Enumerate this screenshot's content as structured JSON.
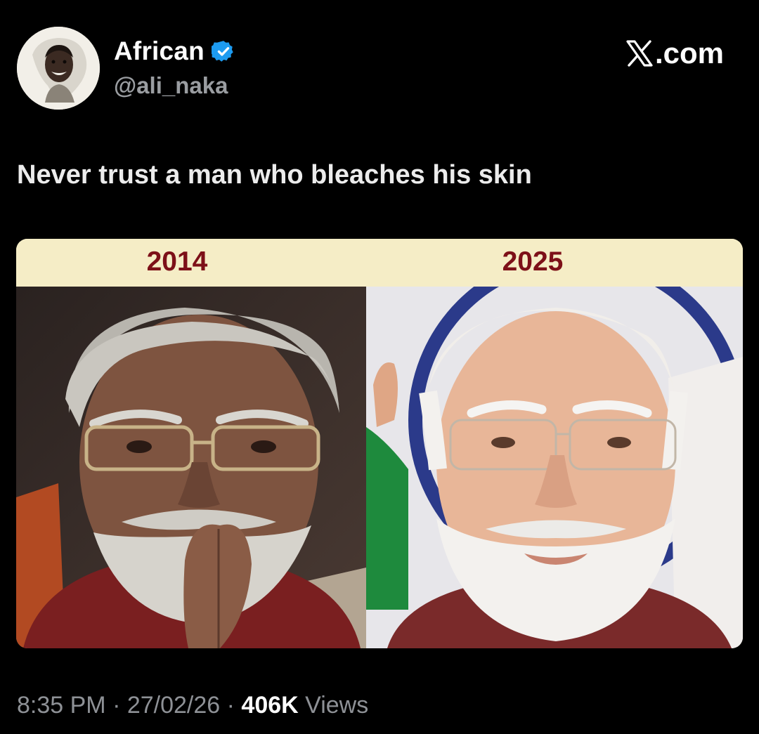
{
  "author": {
    "display_name": "African",
    "handle": "@ali_naka",
    "avatar_icon": "portrait-avatar",
    "verified_icon": "verified-badge-icon",
    "verified_color": "#1d9bf0"
  },
  "brand": {
    "logo_icon": "x-logo-icon",
    "domain_text": ".com"
  },
  "tweet": {
    "text": "Never trust a man who bleaches his skin"
  },
  "media": {
    "header_color": "#f5edc6",
    "year_color": "#7d1018",
    "left_year": "2014",
    "right_year": "2025"
  },
  "meta": {
    "time": "8:35 PM",
    "separator": " · ",
    "date": "27/02/26",
    "views_count": "406K",
    "views_label": " Views"
  }
}
